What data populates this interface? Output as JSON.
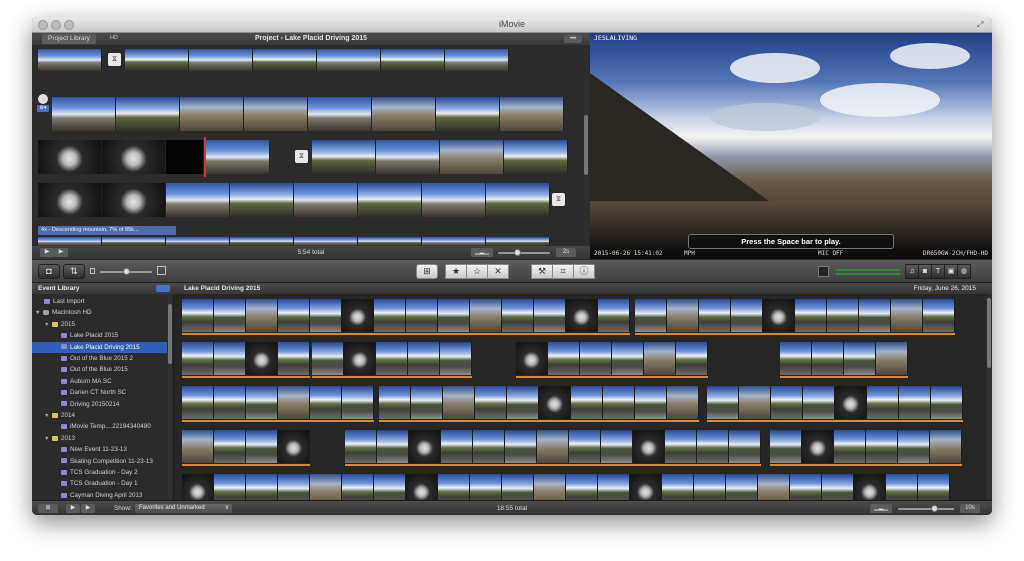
{
  "window": {
    "title": "iMovie"
  },
  "project": {
    "library_tab": "Project Library",
    "hd_badge": "HD",
    "title": "Project - Lake Placid Driving 2015",
    "more_button": "•••",
    "speed_label": "4x - Descending mountain, 7% of 85k...",
    "total": "5:54 total",
    "zoom_label": "2s",
    "transition_icon": "transition-icon",
    "theme_badge": "⚙▾"
  },
  "viewer": {
    "overlay_top": "JESLALIVING",
    "timestamp": "2015-06-26  15:41:02",
    "speed_unit": "MPH",
    "mic_status": "MIC OFF",
    "device": "DR650GW-2CH/FHD-HD",
    "hint": "Press the Space bar to play."
  },
  "toolbar": {
    "icons": [
      "camera-icon",
      "swap-icon",
      "add-to-project-icon",
      "favorite-star-icon",
      "unfavorite-star-icon",
      "reject-x-icon",
      "tools-icon",
      "crop-icon",
      "info-icon",
      "music-icon",
      "photo-icon",
      "title-icon",
      "maps-icon",
      "globe-icon"
    ]
  },
  "event_library": {
    "header": "Event Library",
    "items": [
      {
        "label": "Last Import",
        "type": "import",
        "indent": 1
      },
      {
        "label": "Macintosh HD",
        "type": "disk",
        "indent": 0,
        "expanded": true
      },
      {
        "label": "2015",
        "type": "folder",
        "indent": 1,
        "expanded": true
      },
      {
        "label": "Lake Placid 2015",
        "type": "event",
        "indent": 2
      },
      {
        "label": "Lake Placid Driving 2015",
        "type": "event",
        "indent": 2,
        "selected": true
      },
      {
        "label": "Out of the Blue 2015 2",
        "type": "event",
        "indent": 2
      },
      {
        "label": "Out of the Blue 2015",
        "type": "event",
        "indent": 2
      },
      {
        "label": "Auburn MA SC",
        "type": "event",
        "indent": 2
      },
      {
        "label": "Darien CT North SC",
        "type": "event",
        "indent": 2
      },
      {
        "label": "Driving 20150214",
        "type": "event",
        "indent": 2
      },
      {
        "label": "2014",
        "type": "folder",
        "indent": 1,
        "expanded": true
      },
      {
        "label": "iMovie Temp....22194340480",
        "type": "event",
        "indent": 2
      },
      {
        "label": "2013",
        "type": "folder",
        "indent": 1,
        "expanded": true
      },
      {
        "label": "New Event 11-23-13",
        "type": "event",
        "indent": 2
      },
      {
        "label": "Skating Competition 11-23-13",
        "type": "event",
        "indent": 2
      },
      {
        "label": "TCS Graduation - Day 2",
        "type": "event",
        "indent": 2
      },
      {
        "label": "TCS Graduation - Day 1",
        "type": "event",
        "indent": 2
      },
      {
        "label": "Cayman Diving April 2013",
        "type": "event",
        "indent": 2
      }
    ]
  },
  "event_browser": {
    "title": "Lake Placid Driving 2015",
    "date": "Friday, June 26, 2015"
  },
  "bottombar": {
    "show_label": "Show:",
    "show_value": "Favorites and Unmarked",
    "total": "18:55 total",
    "zoom_label": "10s"
  },
  "colors": {
    "selection": "#2f5fb8",
    "clip_range": "#d98a2a",
    "playhead": "#c04040",
    "speed_label": "#4f6cb0"
  }
}
